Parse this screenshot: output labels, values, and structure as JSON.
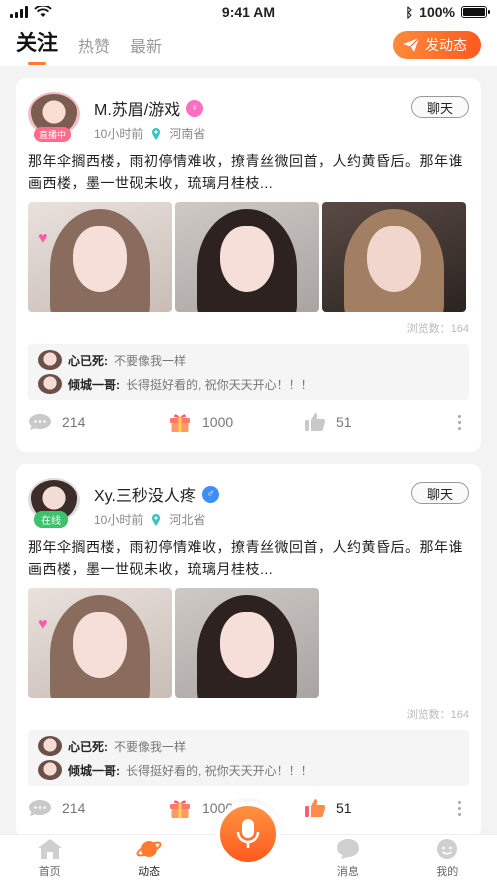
{
  "status_bar": {
    "time": "9:41 AM",
    "battery": "100%"
  },
  "header": {
    "tabs": [
      {
        "label": "关注",
        "active": true
      },
      {
        "label": "热赞",
        "active": false
      },
      {
        "label": "最新",
        "active": false
      }
    ],
    "post_button": "发动态"
  },
  "posts": [
    {
      "username": "M.苏眉/游戏",
      "gender": "female",
      "badge": "直播中",
      "time": "10小时前",
      "location": "河南省",
      "chat_label": "聊天",
      "text": "那年伞搁西楼，雨初停情难收，撩青丝微回首，人约黄昏后。那年谁画西楼，墨一世砚未收，琉璃月桂枝...",
      "views": "浏览数：164",
      "comments": [
        {
          "name": "心已死:",
          "text": "不要像我一样"
        },
        {
          "name": "倾城一哥:",
          "text": "长得挺好看的, 祝你天天开心！！！"
        }
      ],
      "comment_count": "214",
      "gift_count": "1000",
      "like_count": "51",
      "liked": false
    },
    {
      "username": "Xy.三秒没人疼",
      "gender": "male",
      "badge": "在线",
      "time": "10小时前",
      "location": "河北省",
      "chat_label": "聊天",
      "text": "那年伞搁西楼，雨初停情难收，撩青丝微回首，人约黄昏后。那年谁画西楼，墨一世砚未收，琉璃月桂枝...",
      "views": "浏览数：164",
      "comments": [
        {
          "name": "心已死:",
          "text": "不要像我一样"
        },
        {
          "name": "倾城一哥:",
          "text": "长得挺好看的, 祝你天天开心！！！"
        }
      ],
      "comment_count": "214",
      "gift_count": "1000",
      "like_count": "51",
      "liked": true
    }
  ],
  "bottom_nav": [
    {
      "label": "首页",
      "icon": "home-icon"
    },
    {
      "label": "动态",
      "icon": "planet-icon",
      "active": true
    },
    {
      "label": "消息",
      "icon": "message-icon"
    },
    {
      "label": "我的",
      "icon": "profile-icon"
    }
  ],
  "colors": {
    "accent": "#ff6a2a",
    "female": "#ff6ec0",
    "male": "#3d8ef5",
    "online": "#3cc26a",
    "live": "#ff6b8b"
  }
}
